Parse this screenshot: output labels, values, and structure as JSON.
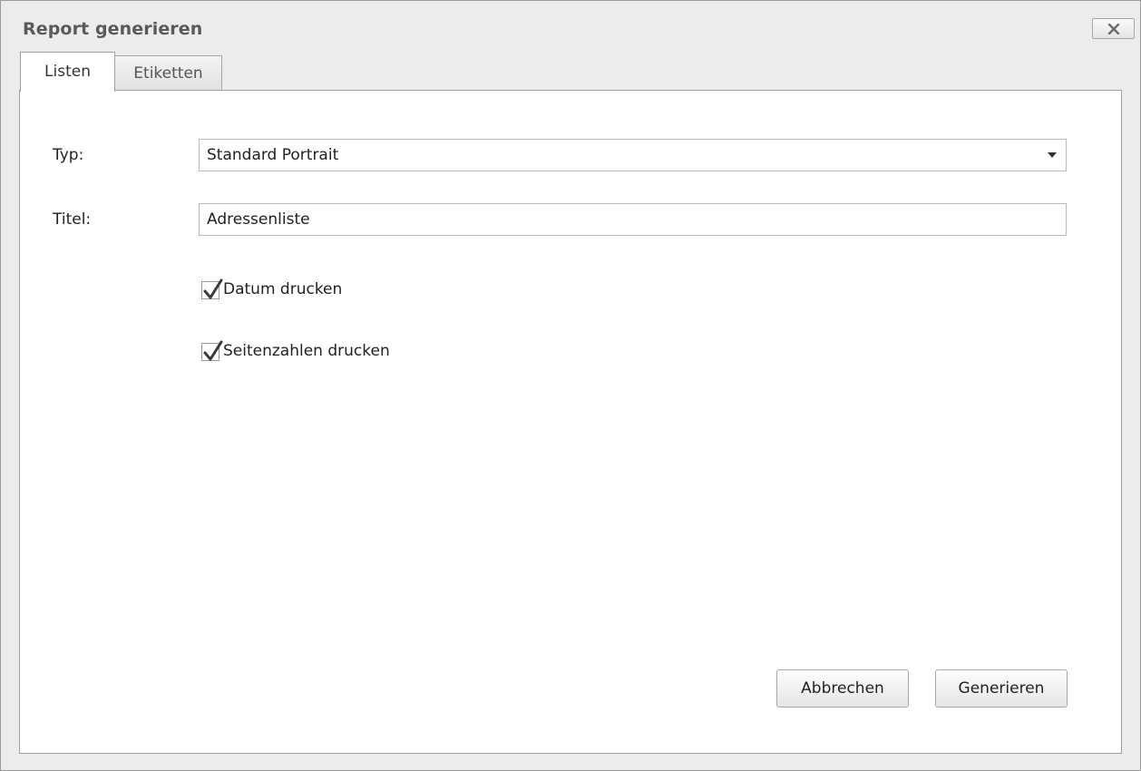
{
  "window": {
    "title": "Report generieren"
  },
  "tabs": [
    {
      "label": "Listen",
      "active": true
    },
    {
      "label": "Etiketten",
      "active": false
    }
  ],
  "form": {
    "typ_label": "Typ:",
    "typ_value": "Standard Portrait",
    "titel_label": "Titel:",
    "titel_value": "Adressenliste",
    "checkboxes": [
      {
        "label": "Datum drucken",
        "checked": true
      },
      {
        "label": "Seitenzahlen drucken",
        "checked": true
      }
    ]
  },
  "buttons": {
    "cancel": "Abbrechen",
    "generate": "Generieren"
  },
  "icons": {
    "close": "close-icon",
    "dropdown": "chevron-down-icon",
    "check": "checkmark-icon"
  }
}
